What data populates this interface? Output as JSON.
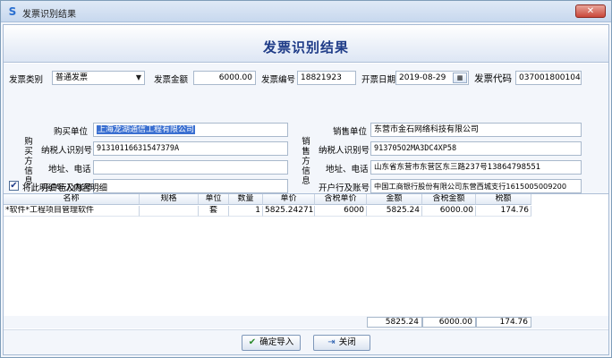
{
  "window": {
    "title": "发票识别结果",
    "close_glyph": "✕"
  },
  "heading": "发票识别结果",
  "invoice": {
    "type_label": "发票类别",
    "type_value": "普通发票",
    "amount_label": "发票金额",
    "amount_value": "6000.00",
    "number_label": "发票编号",
    "number_value": "18821923",
    "date_label": "开票日期",
    "date_value": "2019-08-29",
    "code_label": "发票代码",
    "code_value": "037001800104"
  },
  "buyer": {
    "section_label": "购买方信息",
    "name_label": "购买单位",
    "name_value": "上海龙湖通信工程有限公司",
    "tax_label": "纳税人识别号",
    "tax_value": "91310116631547379A",
    "addr_label": "地址、电话",
    "addr_value": "",
    "bank_label": "开户行及账号",
    "bank_value": ""
  },
  "seller": {
    "section_label": "销售方信息",
    "name_label": "销售单位",
    "name_value": "东营市金石网络科技有限公司",
    "tax_label": "纳税人识别号",
    "tax_value": "913705O2MA3DC4XP58",
    "addr_label": "地址、电话",
    "addr_value": "山东省东营市东营区东三路237号13864798551",
    "bank_label": "开户行及账号",
    "bank_value": "中国工商银行股份有限公司东营西城支行1615005009200"
  },
  "import_detail": {
    "label": "将此明细导入内容明细",
    "checked": true
  },
  "table": {
    "headers": [
      "名称",
      "规格",
      "单位",
      "数量",
      "单价",
      "含税单价",
      "金额",
      "含税金额",
      "税额"
    ],
    "rows": [
      [
        "*软件*工程项目管理软件",
        "",
        "套",
        "1",
        "5825.242718",
        "6000",
        "5825.24",
        "6000.00",
        "174.76"
      ]
    ]
  },
  "totals": {
    "amount": "5825.24",
    "amount_with_tax": "6000.00",
    "tax": "174.76"
  },
  "buttons": {
    "confirm_label": "确定导入",
    "close_label": "关闭"
  },
  "icons": {
    "app": "S",
    "check": "✔",
    "exit": "⇥",
    "dropdown": "▼",
    "calendar": "▦"
  },
  "colors": {
    "heading": "#1f3c88",
    "selection": "#3a6fd1"
  }
}
